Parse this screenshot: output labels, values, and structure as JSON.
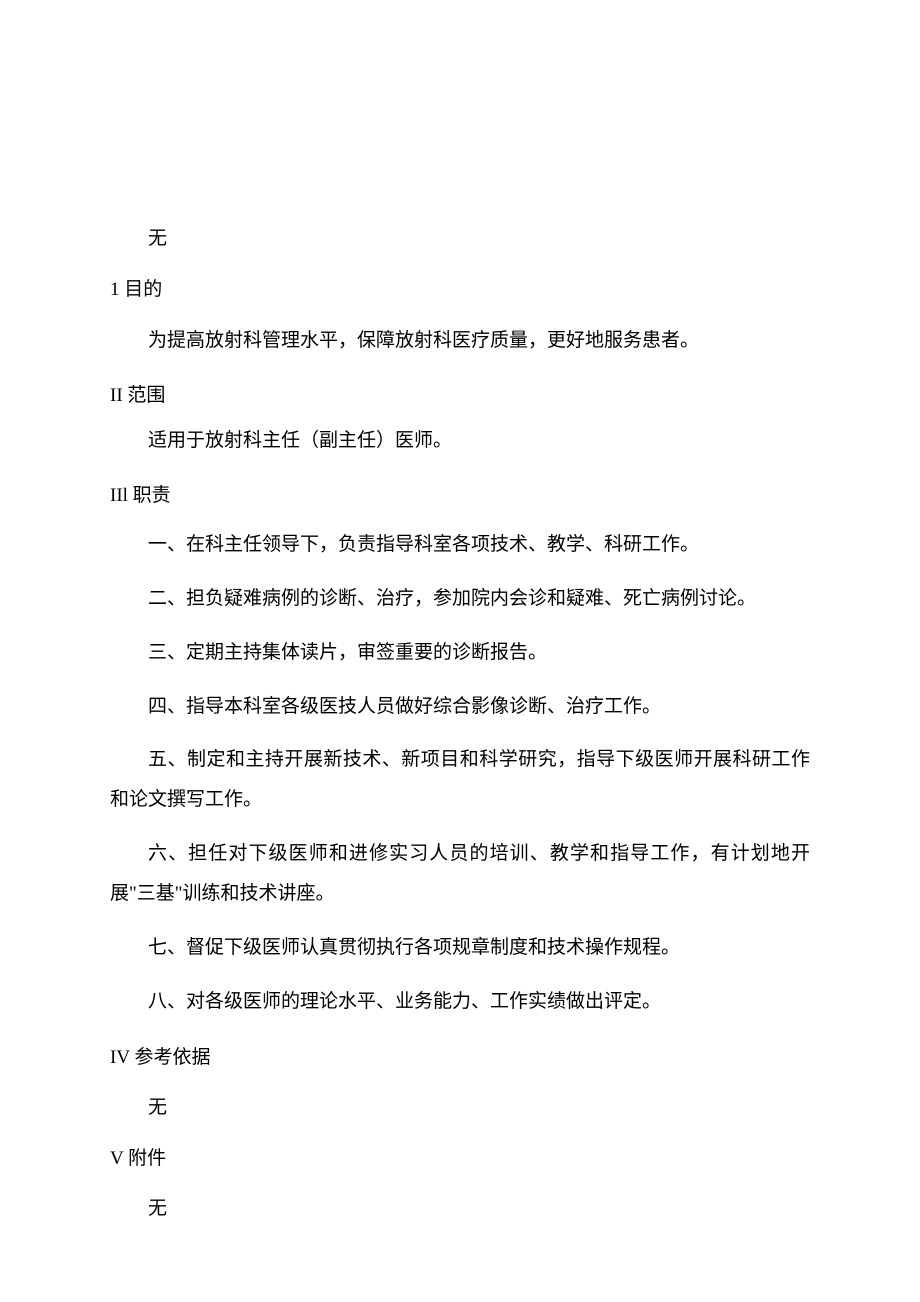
{
  "top_wu": "无",
  "sections": {
    "s1": {
      "heading": "1 目的",
      "content": "为提高放射科管理水平，保障放射科医疗质量，更好地服务患者。"
    },
    "s2": {
      "heading": "II 范围",
      "content": "适用于放射科主任（副主任）医师。"
    },
    "s3": {
      "heading": "IIl 职责",
      "items": [
        "一、在科主任领导下，负责指导科室各项技术、教学、科研工作。",
        "二、担负疑难病例的诊断、治疗，参加院内会诊和疑难、死亡病例讨论。",
        "三、定期主持集体读片，审签重要的诊断报告。",
        "四、指导本科室各级医技人员做好综合影像诊断、治疗工作。",
        "五、制定和主持开展新技术、新项目和科学研究，指导下级医师开展科研工作和论文撰写工作。",
        "六、担任对下级医师和进修实习人员的培训、教学和指导工作，有计划地开展\"三基\"训练和技术讲座。",
        "七、督促下级医师认真贯彻执行各项规章制度和技术操作规程。",
        "八、对各级医师的理论水平、业务能力、工作实绩做出评定。"
      ]
    },
    "s4": {
      "heading": "IV 参考依据",
      "content": "无"
    },
    "s5": {
      "heading": "V 附件",
      "content": "无"
    }
  }
}
